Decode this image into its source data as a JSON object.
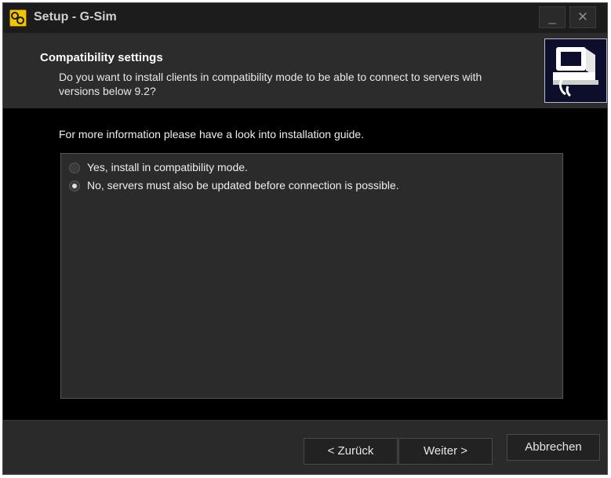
{
  "window": {
    "title": "Setup - G-Sim",
    "minimize_glyph": "_",
    "close_glyph": "✕"
  },
  "header": {
    "title": "Compatibility settings",
    "subtitle": "Do you want to install clients in compatibility mode to be able to connect to servers with versions below 9.2?",
    "image_icon": "computer-setup-icon"
  },
  "body": {
    "info": "For more information please have a look into installation guide.",
    "options": [
      {
        "label": "Yes, install in compatibility mode.",
        "selected": false
      },
      {
        "label": "No, servers must also be updated before connection is possible.",
        "selected": true
      }
    ]
  },
  "footer": {
    "back_label": "< Zurück",
    "next_label": "Weiter >",
    "cancel_label": "Abbrechen"
  },
  "colors": {
    "accent": "#f5c400",
    "background": "#000000",
    "panel": "#2c2c2c"
  }
}
